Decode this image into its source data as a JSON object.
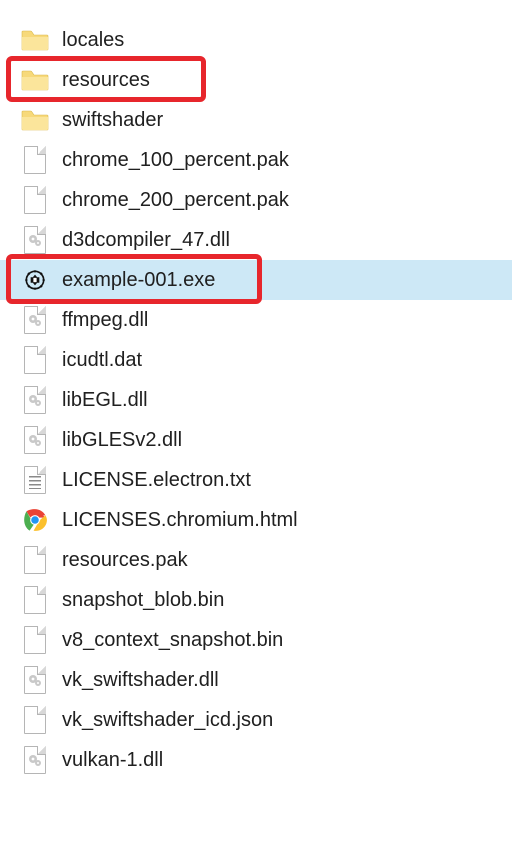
{
  "files": [
    {
      "name": "locales",
      "icon": "folder",
      "selected": false,
      "highlight": false
    },
    {
      "name": "resources",
      "icon": "folder",
      "selected": false,
      "highlight": true
    },
    {
      "name": "swiftshader",
      "icon": "folder",
      "selected": false,
      "highlight": false
    },
    {
      "name": "chrome_100_percent.pak",
      "icon": "file",
      "selected": false,
      "highlight": false
    },
    {
      "name": "chrome_200_percent.pak",
      "icon": "file",
      "selected": false,
      "highlight": false
    },
    {
      "name": "d3dcompiler_47.dll",
      "icon": "gear",
      "selected": false,
      "highlight": false
    },
    {
      "name": "example-001.exe",
      "icon": "exe",
      "selected": true,
      "highlight": true
    },
    {
      "name": "ffmpeg.dll",
      "icon": "gear",
      "selected": false,
      "highlight": false
    },
    {
      "name": "icudtl.dat",
      "icon": "file",
      "selected": false,
      "highlight": false
    },
    {
      "name": "libEGL.dll",
      "icon": "gear",
      "selected": false,
      "highlight": false
    },
    {
      "name": "libGLESv2.dll",
      "icon": "gear",
      "selected": false,
      "highlight": false
    },
    {
      "name": "LICENSE.electron.txt",
      "icon": "text",
      "selected": false,
      "highlight": false
    },
    {
      "name": "LICENSES.chromium.html",
      "icon": "chrome",
      "selected": false,
      "highlight": false
    },
    {
      "name": "resources.pak",
      "icon": "file",
      "selected": false,
      "highlight": false
    },
    {
      "name": "snapshot_blob.bin",
      "icon": "file",
      "selected": false,
      "highlight": false
    },
    {
      "name": "v8_context_snapshot.bin",
      "icon": "file",
      "selected": false,
      "highlight": false
    },
    {
      "name": "vk_swiftshader.dll",
      "icon": "gear",
      "selected": false,
      "highlight": false
    },
    {
      "name": "vk_swiftshader_icd.json",
      "icon": "file",
      "selected": false,
      "highlight": false
    },
    {
      "name": "vulkan-1.dll",
      "icon": "gear",
      "selected": false,
      "highlight": false
    }
  ],
  "colors": {
    "highlight_border": "#e7262c",
    "selection_bg": "#cde8f6"
  }
}
